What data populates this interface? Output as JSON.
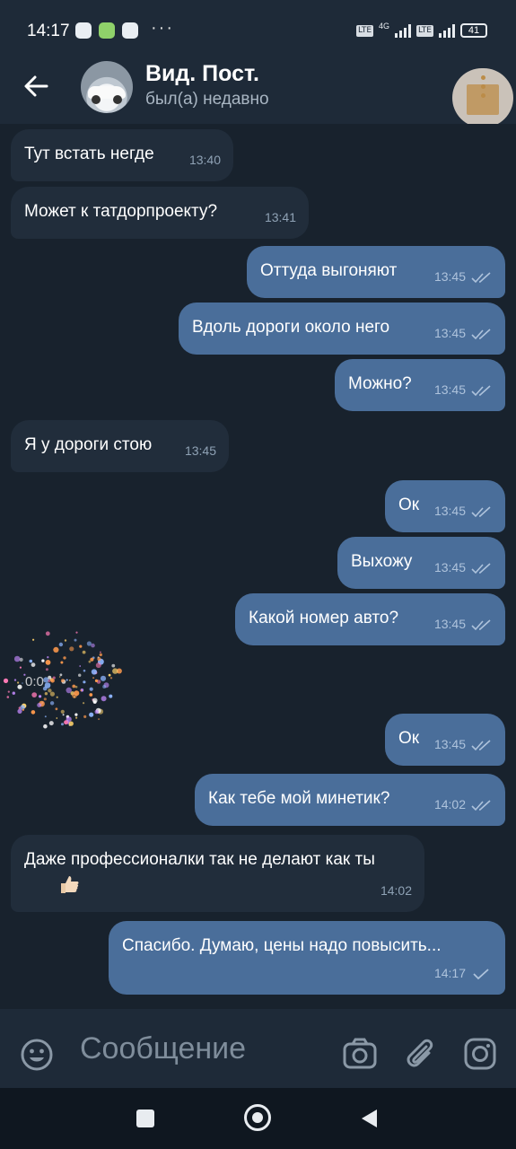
{
  "status_bar": {
    "time": "14:17",
    "network_label": "4G",
    "lte_badge": "LTE",
    "battery": "41",
    "more_dots": "···"
  },
  "header": {
    "title": "Вид. Пост.",
    "subtitle": "был(а) недавно"
  },
  "messages": [
    {
      "dir": "in",
      "text": "Тут встать негде",
      "time": "13:40"
    },
    {
      "dir": "in",
      "text": "Может к татдорпроекту?",
      "time": "13:41"
    },
    {
      "dir": "out",
      "text": "Оттуда выгоняют",
      "time": "13:45"
    },
    {
      "dir": "out",
      "text": "Вдоль дороги около него",
      "time": "13:45"
    },
    {
      "dir": "out",
      "text": "Можно?",
      "time": "13:45"
    },
    {
      "dir": "in",
      "text": "Я у дороги стою",
      "time": "13:45"
    },
    {
      "dir": "out",
      "text": "Ок",
      "time": "13:45"
    },
    {
      "dir": "out",
      "text": "Выхожу",
      "time": "13:45"
    },
    {
      "dir": "out",
      "text": "Какой номер авто?",
      "time": "13:45"
    },
    {
      "dir": "out",
      "text": "Ок",
      "time": "13:45"
    },
    {
      "dir": "out",
      "text": "Как тебе мой минетик?",
      "time": "14:02"
    },
    {
      "dir": "in",
      "text": "Даже профессионалки так не делают как ты",
      "time": "14:02"
    },
    {
      "dir": "out",
      "text": "Спасибо. Думаю, цены надо повысить...",
      "time": "14:17"
    }
  ],
  "sticker": {
    "caption": "0:0"
  },
  "composer": {
    "placeholder": "Сообщение"
  },
  "colors": {
    "background": "#18222d",
    "incoming_bubble": "#212d3b",
    "outgoing_bubble": "#4a6e9a",
    "bar": "#1e2a38"
  },
  "icons": [
    "back-arrow-icon",
    "more-vert-icon",
    "emoji-icon",
    "camera-icon",
    "attach-icon",
    "instagram-icon",
    "read-checks-icon",
    "thumbs-up-emoji"
  ]
}
